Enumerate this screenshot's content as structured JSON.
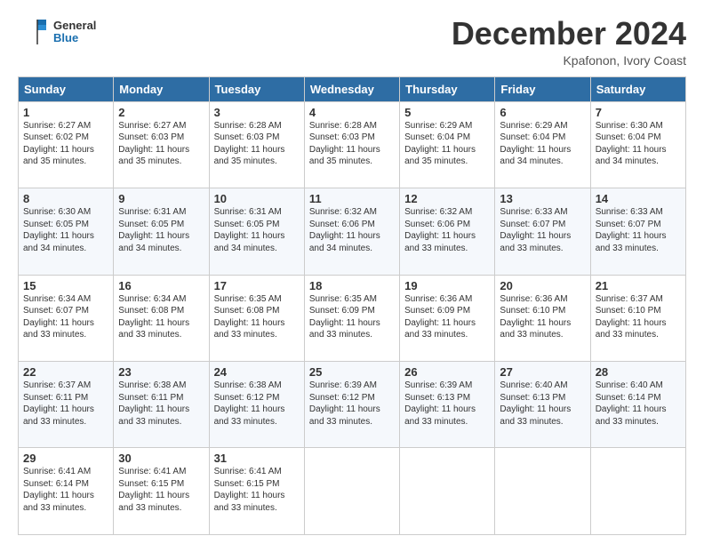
{
  "header": {
    "logo_line1": "General",
    "logo_line2": "Blue",
    "month_title": "December 2024",
    "subtitle": "Kpafonon, Ivory Coast"
  },
  "days_of_week": [
    "Sunday",
    "Monday",
    "Tuesday",
    "Wednesday",
    "Thursday",
    "Friday",
    "Saturday"
  ],
  "weeks": [
    [
      {
        "day": "1",
        "sunrise": "6:27 AM",
        "sunset": "6:02 PM",
        "daylight": "11 hours and 35 minutes."
      },
      {
        "day": "2",
        "sunrise": "6:27 AM",
        "sunset": "6:03 PM",
        "daylight": "11 hours and 35 minutes."
      },
      {
        "day": "3",
        "sunrise": "6:28 AM",
        "sunset": "6:03 PM",
        "daylight": "11 hours and 35 minutes."
      },
      {
        "day": "4",
        "sunrise": "6:28 AM",
        "sunset": "6:03 PM",
        "daylight": "11 hours and 35 minutes."
      },
      {
        "day": "5",
        "sunrise": "6:29 AM",
        "sunset": "6:04 PM",
        "daylight": "11 hours and 35 minutes."
      },
      {
        "day": "6",
        "sunrise": "6:29 AM",
        "sunset": "6:04 PM",
        "daylight": "11 hours and 34 minutes."
      },
      {
        "day": "7",
        "sunrise": "6:30 AM",
        "sunset": "6:04 PM",
        "daylight": "11 hours and 34 minutes."
      }
    ],
    [
      {
        "day": "8",
        "sunrise": "6:30 AM",
        "sunset": "6:05 PM",
        "daylight": "11 hours and 34 minutes."
      },
      {
        "day": "9",
        "sunrise": "6:31 AM",
        "sunset": "6:05 PM",
        "daylight": "11 hours and 34 minutes."
      },
      {
        "day": "10",
        "sunrise": "6:31 AM",
        "sunset": "6:05 PM",
        "daylight": "11 hours and 34 minutes."
      },
      {
        "day": "11",
        "sunrise": "6:32 AM",
        "sunset": "6:06 PM",
        "daylight": "11 hours and 34 minutes."
      },
      {
        "day": "12",
        "sunrise": "6:32 AM",
        "sunset": "6:06 PM",
        "daylight": "11 hours and 33 minutes."
      },
      {
        "day": "13",
        "sunrise": "6:33 AM",
        "sunset": "6:07 PM",
        "daylight": "11 hours and 33 minutes."
      },
      {
        "day": "14",
        "sunrise": "6:33 AM",
        "sunset": "6:07 PM",
        "daylight": "11 hours and 33 minutes."
      }
    ],
    [
      {
        "day": "15",
        "sunrise": "6:34 AM",
        "sunset": "6:07 PM",
        "daylight": "11 hours and 33 minutes."
      },
      {
        "day": "16",
        "sunrise": "6:34 AM",
        "sunset": "6:08 PM",
        "daylight": "11 hours and 33 minutes."
      },
      {
        "day": "17",
        "sunrise": "6:35 AM",
        "sunset": "6:08 PM",
        "daylight": "11 hours and 33 minutes."
      },
      {
        "day": "18",
        "sunrise": "6:35 AM",
        "sunset": "6:09 PM",
        "daylight": "11 hours and 33 minutes."
      },
      {
        "day": "19",
        "sunrise": "6:36 AM",
        "sunset": "6:09 PM",
        "daylight": "11 hours and 33 minutes."
      },
      {
        "day": "20",
        "sunrise": "6:36 AM",
        "sunset": "6:10 PM",
        "daylight": "11 hours and 33 minutes."
      },
      {
        "day": "21",
        "sunrise": "6:37 AM",
        "sunset": "6:10 PM",
        "daylight": "11 hours and 33 minutes."
      }
    ],
    [
      {
        "day": "22",
        "sunrise": "6:37 AM",
        "sunset": "6:11 PM",
        "daylight": "11 hours and 33 minutes."
      },
      {
        "day": "23",
        "sunrise": "6:38 AM",
        "sunset": "6:11 PM",
        "daylight": "11 hours and 33 minutes."
      },
      {
        "day": "24",
        "sunrise": "6:38 AM",
        "sunset": "6:12 PM",
        "daylight": "11 hours and 33 minutes."
      },
      {
        "day": "25",
        "sunrise": "6:39 AM",
        "sunset": "6:12 PM",
        "daylight": "11 hours and 33 minutes."
      },
      {
        "day": "26",
        "sunrise": "6:39 AM",
        "sunset": "6:13 PM",
        "daylight": "11 hours and 33 minutes."
      },
      {
        "day": "27",
        "sunrise": "6:40 AM",
        "sunset": "6:13 PM",
        "daylight": "11 hours and 33 minutes."
      },
      {
        "day": "28",
        "sunrise": "6:40 AM",
        "sunset": "6:14 PM",
        "daylight": "11 hours and 33 minutes."
      }
    ],
    [
      {
        "day": "29",
        "sunrise": "6:41 AM",
        "sunset": "6:14 PM",
        "daylight": "11 hours and 33 minutes."
      },
      {
        "day": "30",
        "sunrise": "6:41 AM",
        "sunset": "6:15 PM",
        "daylight": "11 hours and 33 minutes."
      },
      {
        "day": "31",
        "sunrise": "6:41 AM",
        "sunset": "6:15 PM",
        "daylight": "11 hours and 33 minutes."
      },
      null,
      null,
      null,
      null
    ]
  ]
}
